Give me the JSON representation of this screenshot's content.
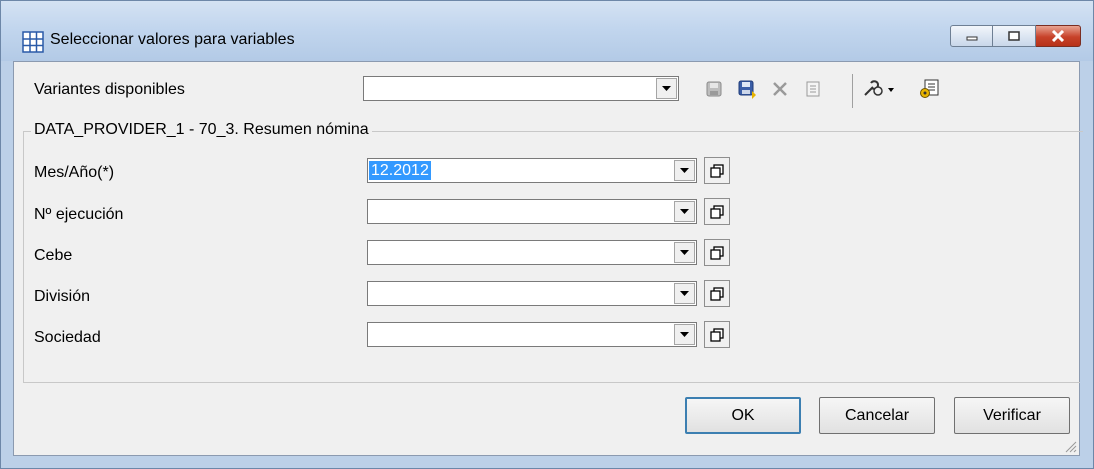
{
  "window": {
    "title": "Seleccionar valores para variables",
    "icon": "grid-table-icon"
  },
  "variants": {
    "label": "Variantes disponibles",
    "value": ""
  },
  "toolbar": {
    "icons": [
      "save-icon",
      "save-as-icon",
      "delete-icon",
      "details-icon",
      "tools-dropdown-icon",
      "personalize-icon"
    ]
  },
  "group": {
    "title": "DATA_PROVIDER_1 - 70_3. Resumen nómina",
    "fields": [
      {
        "label": "Mes/Año(*)",
        "value": "12.2012",
        "selected": true
      },
      {
        "label": "Nº ejecución",
        "value": ""
      },
      {
        "label": "Cebe",
        "value": ""
      },
      {
        "label": "División",
        "value": ""
      },
      {
        "label": "Sociedad",
        "value": ""
      }
    ]
  },
  "buttons": {
    "ok": "OK",
    "cancel": "Cancelar",
    "verify": "Verificar"
  },
  "colors": {
    "selection": "#3399ff",
    "titlebar": "#c2d6ee",
    "close": "#c7422a"
  }
}
